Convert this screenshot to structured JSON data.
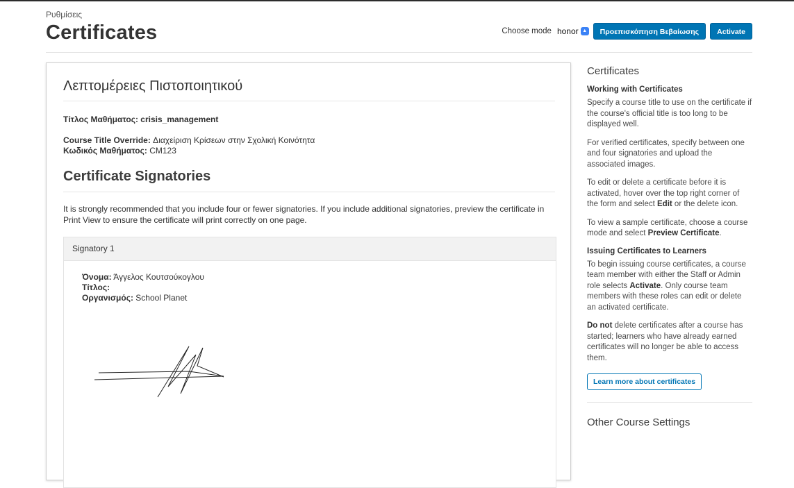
{
  "header": {
    "breadcrumb": "Ρυθμίσεις",
    "title": "Certificates",
    "mode_label": "Choose mode",
    "mode_value": "honor",
    "preview_button": "Προεπισκόπηση Βεβαίωσης",
    "activate_button": "Activate"
  },
  "details": {
    "title": "Λεπτομέρειες Πιστοποιητικού",
    "course_title_label": "Τίτλος Μαθήματος:",
    "course_title_value": "crisis_management",
    "override_label": "Course Title Override:",
    "override_value": "Διαχείριση Κρίσεων στην Σχολική Κοινότητα",
    "course_code_label": "Κωδικός Μαθήματος:",
    "course_code_value": "CM123"
  },
  "signatories": {
    "heading": "Certificate Signatories",
    "note": "It is strongly recommended that you include four or fewer signatories. If you include additional signatories, preview the certificate in Print View to ensure the certificate will print correctly on one page.",
    "items": [
      {
        "header": "Signatory 1",
        "name_label": "Όνομα:",
        "name_value": "Άγγελος Κουτσούκογλου",
        "title_label": "Τίτλος:",
        "title_value": "",
        "org_label": "Οργανισμός:",
        "org_value": "School Planet"
      }
    ]
  },
  "sidebar": {
    "title": "Certificates",
    "section1_title": "Working with Certificates",
    "p1": "Specify a course title to use on the certificate if the course's official title is too long to be displayed well.",
    "p2": "For verified certificates, specify between one and four signatories and upload the associated images.",
    "p3_pre": "To edit or delete a certificate before it is activated, hover over the top right corner of the form and select ",
    "p3_bold": "Edit",
    "p3_post": " or the delete icon.",
    "p4_pre": "To view a sample certificate, choose a course mode and select ",
    "p4_bold": "Preview Certificate",
    "p4_post": ".",
    "section2_title": "Issuing Certificates to Learners",
    "p5_pre": "To begin issuing course certificates, a course team member with either the Staff or Admin role selects ",
    "p5_bold": "Activate",
    "p5_post": ". Only course team members with these roles can edit or delete an activated certificate.",
    "p6_bold": "Do not",
    "p6_post": " delete certificates after a course has started; learners who have already earned certificates will no longer be able to access them.",
    "learn_more_button": "Learn more about certificates",
    "other_settings_title": "Other Course Settings"
  },
  "colors": {
    "primary": "#0075b4",
    "panel_header": "#f2f2f2"
  }
}
